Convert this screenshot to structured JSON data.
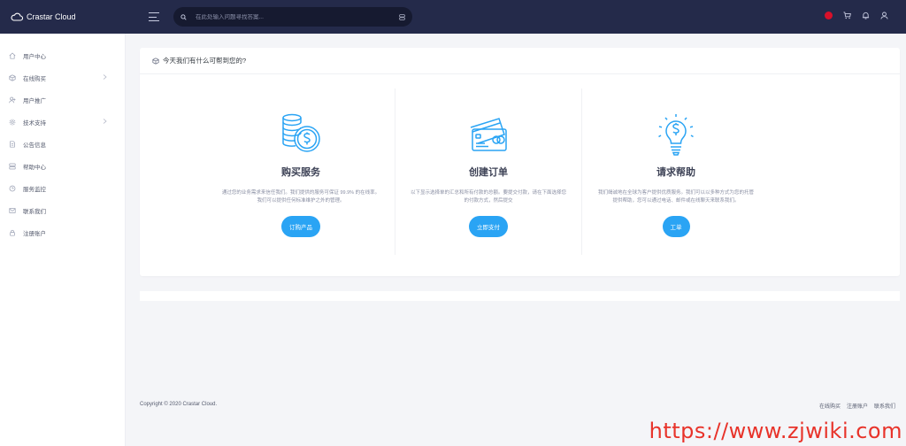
{
  "brand": {
    "name": "Crastar Cloud"
  },
  "search": {
    "placeholder": "在此处输入问题寻找答案..."
  },
  "sidebar": {
    "items": [
      {
        "label": "用户中心",
        "icon": "home-icon",
        "has_children": false
      },
      {
        "label": "在线购买",
        "icon": "box-icon",
        "has_children": true
      },
      {
        "label": "用户推广",
        "icon": "user-plus-icon",
        "has_children": false
      },
      {
        "label": "技术支持",
        "icon": "gear-icon",
        "has_children": true
      },
      {
        "label": "公告信息",
        "icon": "document-icon",
        "has_children": false
      },
      {
        "label": "帮助中心",
        "icon": "server-icon",
        "has_children": false
      },
      {
        "label": "服务监控",
        "icon": "clock-icon",
        "has_children": false
      },
      {
        "label": "联系我们",
        "icon": "mail-icon",
        "has_children": false
      },
      {
        "label": "注册账户",
        "icon": "lock-icon",
        "has_children": false
      }
    ]
  },
  "card": {
    "title": "今天我们有什么可帮到您的?",
    "columns": [
      {
        "heading": "购买服务",
        "description": "通过您的业务需求来信任我们。我们提供的服务可保证 99.9% 的在线率。我们可以提供任何标准维护之外的管理。",
        "button": "订购产品",
        "icon": "coins-icon"
      },
      {
        "heading": "创建订单",
        "description": "以下显示选择单的汇总和所有付款的总额。要提交付款，请在下面选择您的付款方式，然后提交",
        "button": "立即支付",
        "icon": "credit-card-icon"
      },
      {
        "heading": "请求帮助",
        "description": "我们竭诚地在全球为客户提供优质服务。我们可以以多种方式为您的托管提供帮助，您可以通过电话、邮件或在线聊天来联系我们。",
        "button": "工单",
        "icon": "lightbulb-icon"
      }
    ]
  },
  "footer": {
    "copyright": "Copyright © 2020 Crastar Cloud.",
    "links": [
      "在线购买",
      "注册账户",
      "联系我们"
    ]
  },
  "watermark": "https://www.zjwiki.com",
  "colors": {
    "topbar": "#242a4a",
    "accent": "#2aa4f4",
    "watermark": "#e8332a"
  }
}
